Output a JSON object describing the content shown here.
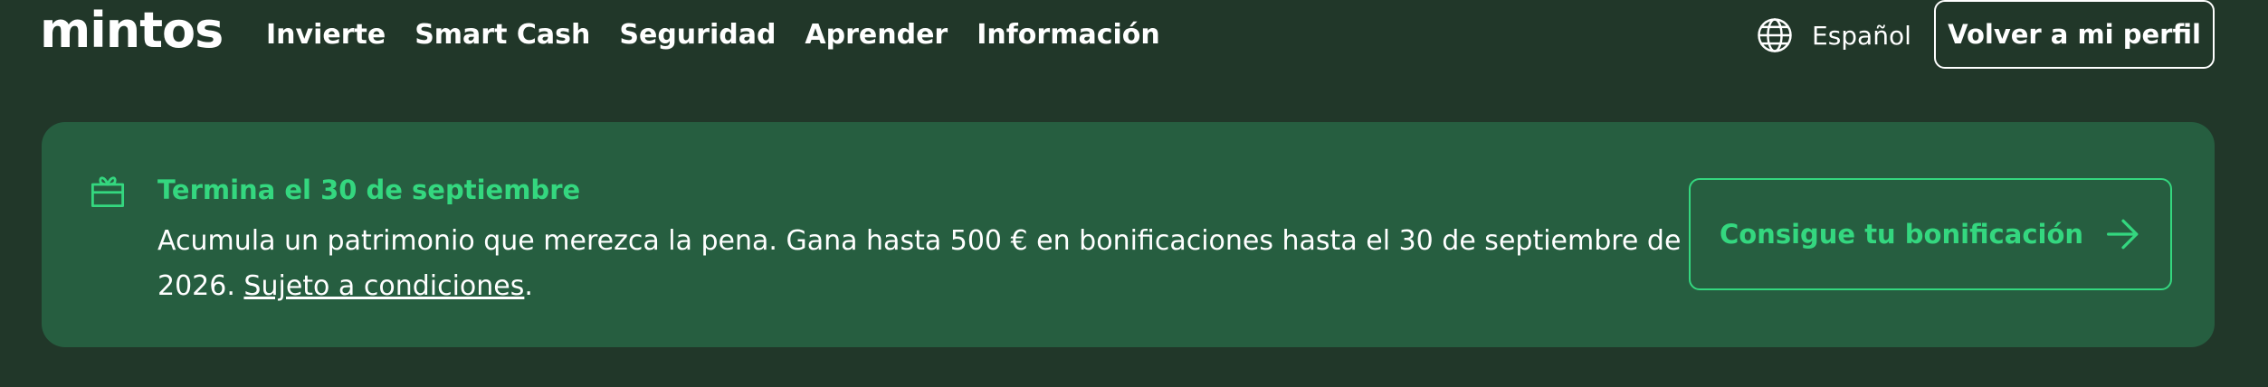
{
  "header": {
    "logo": "mintos",
    "nav": [
      {
        "label": "Invierte"
      },
      {
        "label": "Smart Cash"
      },
      {
        "label": "Seguridad"
      },
      {
        "label": "Aprender"
      },
      {
        "label": "Información"
      }
    ],
    "language": {
      "label": "Español",
      "icon": "globe-icon"
    },
    "profile_button": "Volver a mi perfil"
  },
  "banner": {
    "icon": "gift-icon",
    "title": "Termina el 30 de septiembre",
    "text": "Acumula un patrimonio que merezca la pena. Gana hasta 500 € en bonificaciones hasta el 30 de septiembre de 2026. ",
    "link": "Sujeto a condiciones",
    "text_end": ".",
    "cta": {
      "label": "Consigue tu bonificación",
      "icon": "arrow-right-icon"
    }
  },
  "colors": {
    "background": "#213729",
    "banner": "#265e40",
    "accent": "#34d77f",
    "text": "#ffffff"
  }
}
